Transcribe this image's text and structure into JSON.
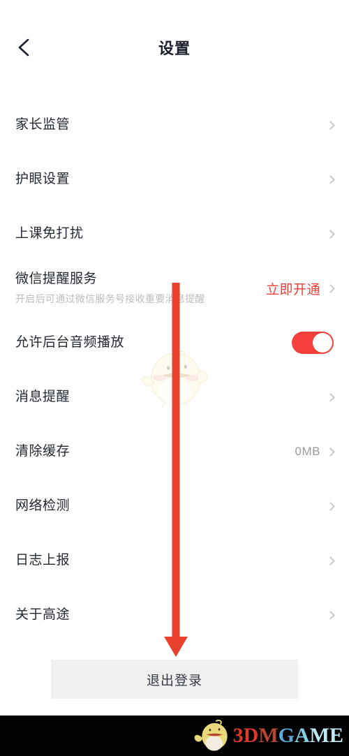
{
  "header": {
    "title": "设置",
    "back_icon": "chevron-left-icon"
  },
  "settings": {
    "items": [
      {
        "label": "家长监管",
        "value": "",
        "type": "chevron"
      },
      {
        "label": "护眼设置",
        "value": "",
        "type": "chevron"
      },
      {
        "label": "上课免打扰",
        "value": "",
        "type": "chevron"
      },
      {
        "label": "微信提醒服务",
        "sub": "开启后可通过微信服务号接收重要消息提醒",
        "action": "立即开通",
        "type": "action"
      },
      {
        "label": "允许后台音频播放",
        "value": "",
        "type": "toggle",
        "toggle_on": true
      },
      {
        "label": "消息提醒",
        "value": "",
        "type": "chevron"
      },
      {
        "label": "清除缓存",
        "value": "0MB",
        "type": "value"
      },
      {
        "label": "网络检测",
        "value": "",
        "type": "chevron"
      },
      {
        "label": "日志上报",
        "value": "",
        "type": "chevron"
      },
      {
        "label": "关于高途",
        "value": "",
        "type": "chevron"
      }
    ]
  },
  "logout": {
    "label": "退出登录"
  },
  "annotation": {
    "arrow_color": "#e8412e",
    "points_to": "退出登录"
  },
  "watermark": {
    "text_3": "3",
    "text_d": "D",
    "text_m": "M",
    "text_g": "G",
    "text_a": "A",
    "text_me": "ME",
    "mascot": "bird-mascot-icon"
  },
  "colors": {
    "accent_red": "#ef4036",
    "toggle_on": "#f43f3c",
    "logout_bg": "#f0f0f0",
    "text_primary": "#222831",
    "text_muted": "#bdbdbd"
  }
}
